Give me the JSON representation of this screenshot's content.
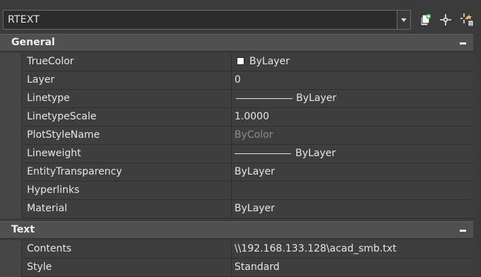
{
  "toolbar": {
    "object_type": "RTEXT",
    "icons": [
      "quick-select-toggle-icon",
      "select-objects-icon",
      "quick-select-icon"
    ]
  },
  "sections": [
    {
      "title": "General",
      "rows": [
        {
          "name": "TrueColor",
          "value": "ByLayer",
          "kind": "color-swatch"
        },
        {
          "name": "Layer",
          "value": "0"
        },
        {
          "name": "Linetype",
          "value": "ByLayer",
          "kind": "linetype"
        },
        {
          "name": "LinetypeScale",
          "value": "1.0000"
        },
        {
          "name": "PlotStyleName",
          "value": "ByColor",
          "disabled": true
        },
        {
          "name": "Lineweight",
          "value": "ByLayer",
          "kind": "linetype"
        },
        {
          "name": "EntityTransparency",
          "value": "ByLayer"
        },
        {
          "name": "Hyperlinks",
          "value": ""
        },
        {
          "name": "Material",
          "value": "ByLayer"
        }
      ]
    },
    {
      "title": "Text",
      "rows": [
        {
          "name": "Contents",
          "value": "\\\\192.168.133.128\\acad_smb.txt"
        },
        {
          "name": "Style",
          "value": "Standard"
        }
      ]
    }
  ],
  "colors": {
    "background": "#3b3b3b",
    "header": "#505050",
    "row": "#3e3e3e"
  }
}
